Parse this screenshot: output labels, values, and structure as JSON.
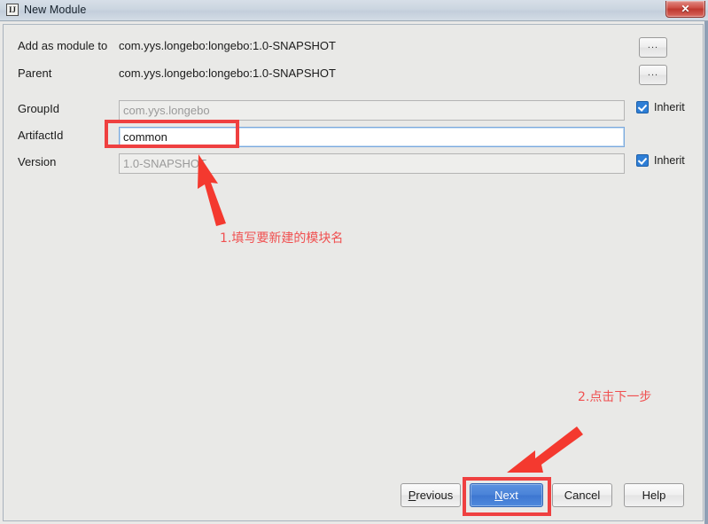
{
  "window": {
    "title": "New Module",
    "icon": "intellij-idea-icon",
    "close_label": "✕"
  },
  "form": {
    "rows": [
      {
        "label": "Add as module to",
        "value": "com.yys.longebo:longebo:1.0-SNAPSHOT",
        "browse_label": "..."
      },
      {
        "label": "Parent",
        "value": "com.yys.longebo:longebo:1.0-SNAPSHOT",
        "browse_label": "..."
      }
    ],
    "fields": [
      {
        "label": "GroupId",
        "value": "com.yys.longebo",
        "inherit_label": "Inherit",
        "inherit_checked": true,
        "disabled": true
      },
      {
        "label": "ArtifactId",
        "value": "common",
        "inherit_label": "",
        "inherit_checked": false,
        "disabled": false
      },
      {
        "label": "Version",
        "value": "1.0-SNAPSHOT",
        "inherit_label": "Inherit",
        "inherit_checked": true,
        "disabled": true
      }
    ]
  },
  "annotations": {
    "step1": "1.填写要新建的模块名",
    "step2": "2.点击下一步",
    "color": "#f05050"
  },
  "footer": {
    "previous": {
      "prefix": "",
      "mnemonic": "P",
      "suffix": "revious"
    },
    "next": {
      "prefix": "",
      "mnemonic": "N",
      "suffix": "ext"
    },
    "cancel": "Cancel",
    "help": "Help"
  }
}
